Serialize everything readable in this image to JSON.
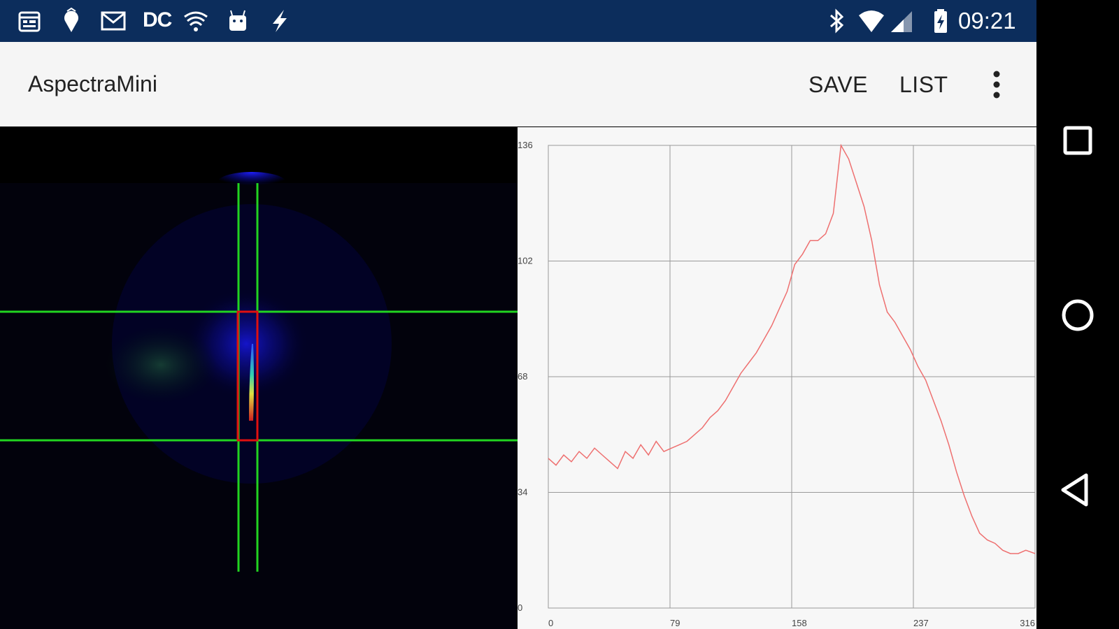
{
  "status_bar": {
    "left_icons": [
      "calendar-icon",
      "location-pin-icon",
      "gmail-icon",
      "dc-icon",
      "signal-waves-icon",
      "android-icon",
      "flash-icon"
    ],
    "dc_label": "DC",
    "right_icons": [
      "bluetooth-icon",
      "wifi-icon",
      "cell-signal-icon",
      "battery-charging-icon"
    ],
    "time": "09:21",
    "background_color": "#0c2d5c"
  },
  "app_bar": {
    "title": "AspectraMini",
    "actions": {
      "save": "SAVE",
      "list": "LIST"
    },
    "overflow_icon": "more-vert-icon"
  },
  "camera_view": {
    "overlay_line_color": "#21d421",
    "selection_box_color": "#e01010"
  },
  "chart_data": {
    "type": "line",
    "series_color": "#ee7070",
    "x_ticks": [
      "0",
      "79",
      "158",
      "237",
      "316"
    ],
    "y_ticks": [
      "136",
      "102",
      "68",
      "34",
      "0"
    ],
    "xlim": [
      0,
      316
    ],
    "ylim": [
      0,
      136
    ],
    "grid": true,
    "series": [
      {
        "x": [
          0,
          5,
          10,
          15,
          20,
          25,
          30,
          35,
          40,
          45,
          50,
          55,
          60,
          65,
          70,
          75,
          80,
          85,
          90,
          95,
          100,
          105,
          110,
          115,
          120,
          125,
          130,
          135,
          140,
          145,
          150,
          155,
          160,
          165,
          170,
          175,
          180,
          185,
          190,
          195,
          200,
          205,
          210,
          215,
          220,
          225,
          230,
          235,
          240,
          245,
          250,
          255,
          260,
          265,
          270,
          275,
          280,
          285,
          290,
          295,
          300,
          305,
          310,
          316
        ],
        "y": [
          44,
          42,
          45,
          43,
          46,
          44,
          47,
          45,
          43,
          41,
          46,
          44,
          48,
          45,
          49,
          46,
          47,
          48,
          49,
          51,
          53,
          56,
          58,
          61,
          65,
          69,
          72,
          75,
          79,
          83,
          88,
          93,
          101,
          104,
          108,
          108,
          110,
          116,
          136,
          132,
          125,
          118,
          108,
          95,
          87,
          84,
          80,
          76,
          71,
          67,
          61,
          55,
          48,
          40,
          33,
          27,
          22,
          20,
          19,
          17,
          16,
          16,
          17,
          16
        ]
      }
    ]
  },
  "nav_bar": {
    "recents_icon": "recents-square-icon",
    "home_icon": "home-circle-icon",
    "back_icon": "back-triangle-icon"
  }
}
